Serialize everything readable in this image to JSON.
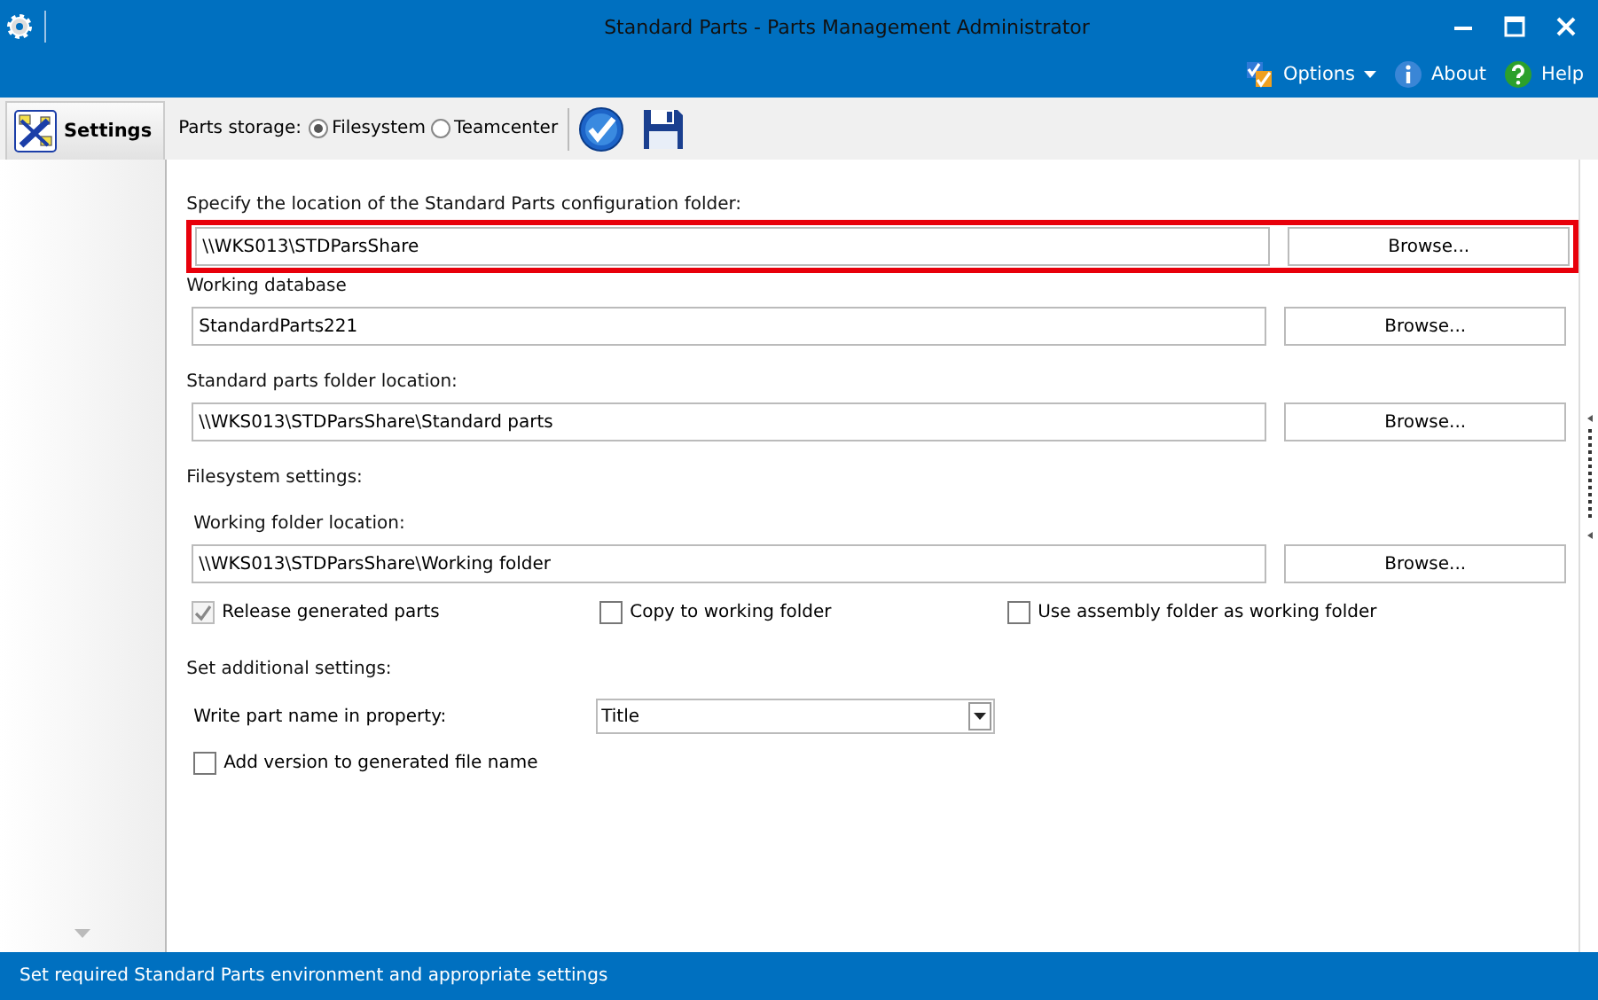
{
  "window": {
    "title": "Standard Parts - Parts Management Administrator"
  },
  "header_menu": [
    {
      "label": "Options",
      "kind": "options"
    },
    {
      "label": "About",
      "kind": "about"
    },
    {
      "label": "Help",
      "kind": "help"
    }
  ],
  "sidebar": {
    "items": [
      {
        "label": "Settings",
        "selected": true
      }
    ]
  },
  "toolbar": {
    "label": "Parts storage:",
    "options": [
      {
        "label": "Filesystem",
        "selected": true
      },
      {
        "label": "Teamcenter",
        "selected": false
      }
    ]
  },
  "fields": [
    {
      "label": "Specify the location of the Standard Parts configuration folder:",
      "value": "\\\\WKS013\\STDParsShare",
      "button": "Browse...",
      "highlighted": true
    },
    {
      "label": "Working database",
      "value": "StandardParts221",
      "button": "Browse...",
      "highlighted": false
    },
    {
      "label": "Standard parts folder location:",
      "value": "\\\\WKS013\\STDParsShare\\Standard parts",
      "button": "Browse...",
      "highlighted": false
    }
  ],
  "filesystem_settings": {
    "heading": "Filesystem settings:",
    "field": {
      "label": "Working folder location:",
      "value": "\\\\WKS013\\STDParsShare\\Working folder",
      "button": "Browse..."
    },
    "checkboxes": [
      {
        "label": "Release generated parts",
        "checked": true,
        "disabled": true
      },
      {
        "label": "Copy to working folder",
        "checked": false,
        "disabled": false
      },
      {
        "label": "Use assembly folder as working folder",
        "checked": false,
        "disabled": false
      }
    ]
  },
  "additional_settings": {
    "heading": "Set additional settings:",
    "property_label": "Write part name in property:",
    "property_value": "Title",
    "checkboxes": [
      {
        "label": "Add version to generated file name",
        "checked": false,
        "disabled": false
      }
    ]
  },
  "status_bar": "Set required Standard Parts environment and appropriate settings"
}
